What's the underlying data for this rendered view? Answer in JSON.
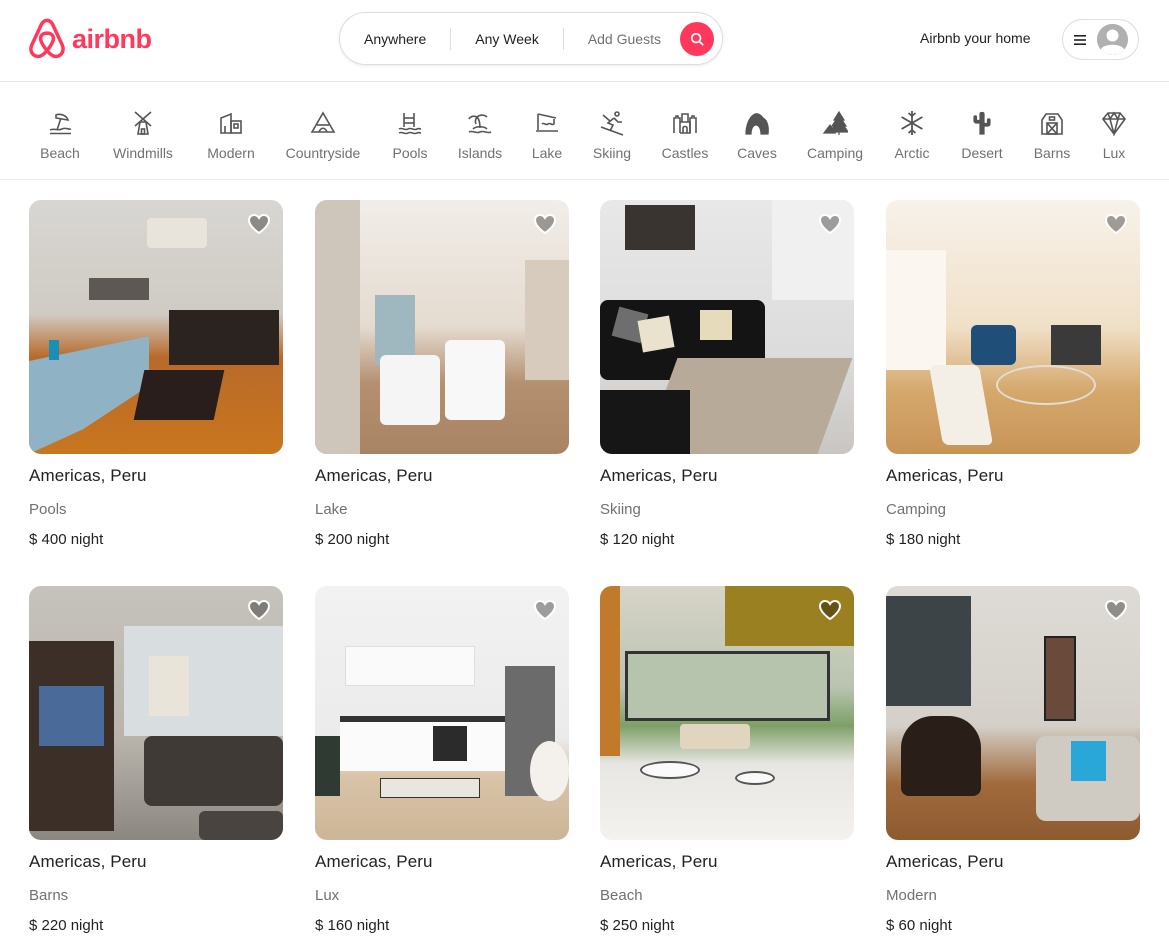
{
  "header": {
    "brand": "airbnb",
    "brand_color": "#ff385c",
    "search": {
      "anywhere": "Anywhere",
      "any_week": "Any Week",
      "add_guests": "Add Guests"
    },
    "host_link": "Airbnb your home"
  },
  "categories": [
    {
      "label": "Beach",
      "icon": "beach-icon"
    },
    {
      "label": "Windmills",
      "icon": "windmill-icon"
    },
    {
      "label": "Modern",
      "icon": "modern-house-icon"
    },
    {
      "label": "Countryside",
      "icon": "countryside-icon"
    },
    {
      "label": "Pools",
      "icon": "pool-icon"
    },
    {
      "label": "Islands",
      "icon": "island-icon"
    },
    {
      "label": "Lake",
      "icon": "lake-icon"
    },
    {
      "label": "Skiing",
      "icon": "skiing-icon"
    },
    {
      "label": "Castles",
      "icon": "castle-icon"
    },
    {
      "label": "Caves",
      "icon": "cave-icon"
    },
    {
      "label": "Camping",
      "icon": "camping-icon"
    },
    {
      "label": "Arctic",
      "icon": "snowflake-icon"
    },
    {
      "label": "Desert",
      "icon": "cactus-icon"
    },
    {
      "label": "Barns",
      "icon": "barn-icon"
    },
    {
      "label": "Lux",
      "icon": "diamond-icon"
    }
  ],
  "listings": [
    {
      "location": "Americas, Peru",
      "category": "Pools",
      "price": "$ 400",
      "unit": "night"
    },
    {
      "location": "Americas, Peru",
      "category": "Lake",
      "price": "$ 200",
      "unit": "night"
    },
    {
      "location": "Americas, Peru",
      "category": "Skiing",
      "price": "$ 120",
      "unit": "night"
    },
    {
      "location": "Americas, Peru",
      "category": "Camping",
      "price": "$ 180",
      "unit": "night"
    },
    {
      "location": "Americas, Peru",
      "category": "Barns",
      "price": "$ 220",
      "unit": "night"
    },
    {
      "location": "Americas, Peru",
      "category": "Lux",
      "price": "$ 160",
      "unit": "night"
    },
    {
      "location": "Americas, Peru",
      "category": "Beach",
      "price": "$ 250",
      "unit": "night"
    },
    {
      "location": "Americas, Peru",
      "category": "Modern",
      "price": "$ 60",
      "unit": "night"
    }
  ]
}
